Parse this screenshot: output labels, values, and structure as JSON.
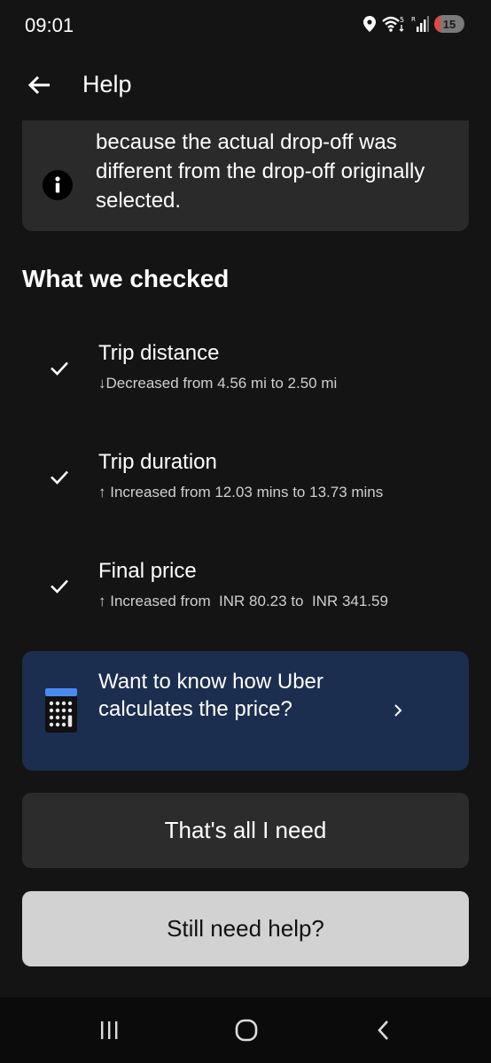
{
  "status_bar": {
    "time": "09:01",
    "battery": "15"
  },
  "header": {
    "title": "Help"
  },
  "info_card": {
    "text": "because the actual drop-off was different from the drop-off originally selected."
  },
  "checked": {
    "title": "What we checked",
    "items": [
      {
        "label": "Trip distance",
        "detail": "↓Decreased from 4.56 mi to 2.50 mi"
      },
      {
        "label": "Trip duration",
        "detail": "↑ Increased from 12.03 mins to 13.73 mins"
      },
      {
        "label": "Final price",
        "detail": "↑ Increased from  INR 80.23 to  INR 341.59"
      }
    ]
  },
  "promo": {
    "text": "Want to know how Uber calculates the price?"
  },
  "buttons": {
    "primary": "That's all I need",
    "secondary": "Still need help?"
  },
  "colors": {
    "background": "#141414",
    "card": "#2a2a2a",
    "promo": "#1b2e4f",
    "secondary_button": "#d2d2d2"
  }
}
